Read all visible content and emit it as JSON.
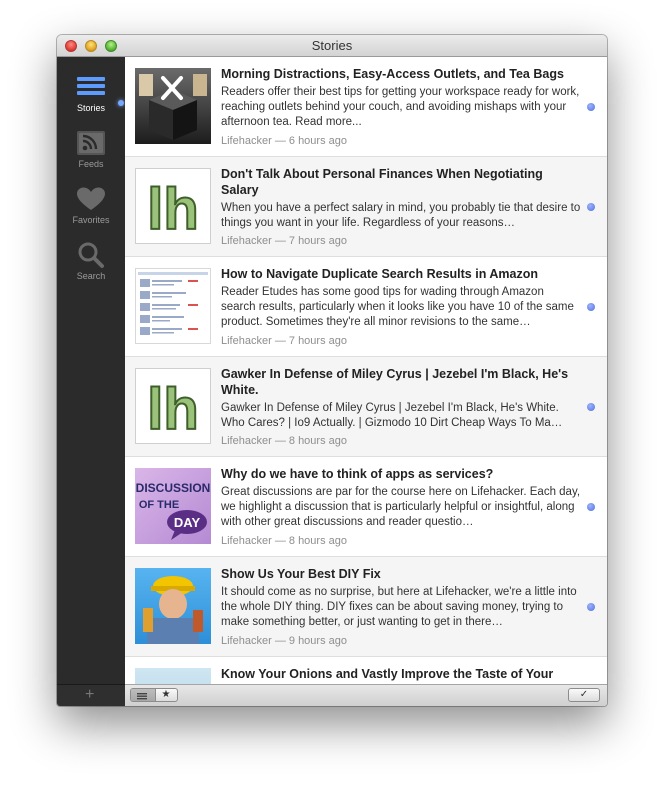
{
  "window": {
    "title": "Stories"
  },
  "sidebar": {
    "items": [
      {
        "label": "Stories",
        "icon": "stories-icon",
        "active": true
      },
      {
        "label": "Feeds",
        "icon": "rss-feeds-icon",
        "active": false
      },
      {
        "label": "Favorites",
        "icon": "heart-icon",
        "active": false
      },
      {
        "label": "Search",
        "icon": "search-icon",
        "active": false
      }
    ],
    "add_label": "+"
  },
  "stories": [
    {
      "title": "Morning Distractions, Easy-Access Outlets, and Tea Bags",
      "summary": "Readers offer their best tips for getting your workspace ready for work, reaching outlets behind your couch, and avoiding mishaps with your afternoon tea. Read more...",
      "source": "Lifehacker",
      "time": "6 hours ago",
      "thumb": "workspace-tools-cube",
      "unread": true
    },
    {
      "title": "Don't Talk About Personal Finances When Negotiating Salary",
      "summary": "When you have a perfect salary in mind, you probably tie that desire to things you want in your life. Regardless of your reasons…",
      "source": "Lifehacker",
      "time": "7 hours ago",
      "thumb": "lifehacker-logo",
      "thumb_text": "lh",
      "unread": true
    },
    {
      "title": "How to Navigate Duplicate Search Results in Amazon",
      "summary": "Reader Etudes has some good tips for wading through Amazon search results, particularly when it looks like you have 10 of the same product. Sometimes they're all minor revisions to the same…",
      "source": "Lifehacker",
      "time": "7 hours ago",
      "thumb": "amazon-search-results-screenshot",
      "unread": true
    },
    {
      "title": "Gawker In Defense of Miley Cyrus | Jezebel I'm Black, He's White.",
      "summary": "Gawker In Defense of Miley Cyrus | Jezebel I'm Black, He's White. Who Cares? | Io9 Actually. | Gizmodo 10 Dirt Cheap Ways To Ma…",
      "source": "Lifehacker",
      "time": "8 hours ago",
      "thumb": "lifehacker-logo",
      "thumb_text": "lh",
      "unread": true
    },
    {
      "title": "Why do we have to think of apps as services?",
      "summary": "Great discussions are par for the course here on Lifehacker. Each day, we highlight a discussion that is particularly helpful or insightful, along with other great discussions and reader questio…",
      "source": "Lifehacker",
      "time": "8 hours ago",
      "thumb": "discussion-of-the-day",
      "thumb_lines": [
        "DISCUSSION",
        "OF THE",
        "DAY"
      ],
      "unread": true
    },
    {
      "title": "Show Us Your Best DIY Fix",
      "summary": "It should come as no surprise, but here at Lifehacker, we're a little into the whole DIY thing. DIY fixes can be about saving money, trying to make something better, or just wanting to get in there…",
      "source": "Lifehacker",
      "time": "9 hours ago",
      "thumb": "diy-worker-with-tools",
      "unread": true
    },
    {
      "title": "Know Your Onions and Vastly Improve the Taste of Your",
      "summary": "",
      "source": "",
      "time": "",
      "thumb": "onions-photo",
      "unread": false
    }
  ],
  "footer": {
    "list_view_icon": "list-icon",
    "favorites_icon": "star-icon",
    "star_glyph": "★",
    "mark_read_glyph": "✓"
  },
  "colors": {
    "sidebar_bg": "#2b2b2b",
    "unread_dot": "#5b7be6",
    "active_blue": "#7aa8ff"
  }
}
